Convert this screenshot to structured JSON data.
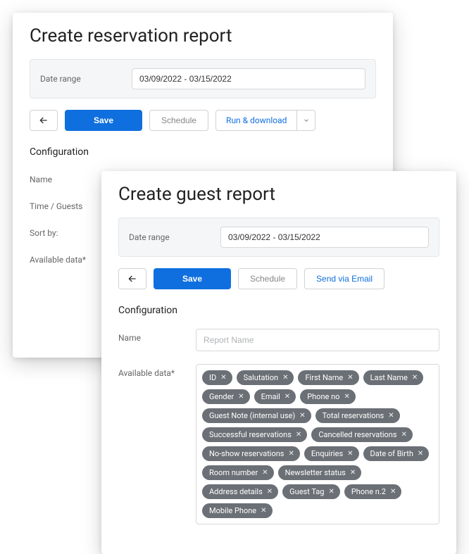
{
  "back_panel": {
    "title": "Create reservation report",
    "date_label": "Date range",
    "date_value": "03/09/2022 - 03/15/2022",
    "buttons": {
      "save": "Save",
      "schedule": "Schedule",
      "run_download": "Run & download"
    },
    "config_heading": "Configuration",
    "rows": {
      "name_label": "Name",
      "time_guests_label": "Time / Guests",
      "sort_by_label": "Sort by:",
      "available_label": "Available data*"
    }
  },
  "front_panel": {
    "title": "Create guest report",
    "date_label": "Date range",
    "date_value": "03/09/2022 - 03/15/2022",
    "buttons": {
      "save": "Save",
      "schedule": "Schedule",
      "send_email": "Send via Email"
    },
    "config_heading": "Configuration",
    "name_label": "Name",
    "name_placeholder": "Report Name",
    "available_label": "Available data*",
    "chips": [
      "ID",
      "Salutation",
      "First Name",
      "Last Name",
      "Gender",
      "Email",
      "Phone no",
      "Guest Note (internal use)",
      "Total reservations",
      "Successful reservations",
      "Cancelled reservations",
      "No-show reservations",
      "Enquiries",
      "Date of Birth",
      "Room number",
      "Newsletter status",
      "Address details",
      "Guest Tag",
      "Phone n.2",
      "Mobile Phone"
    ]
  }
}
